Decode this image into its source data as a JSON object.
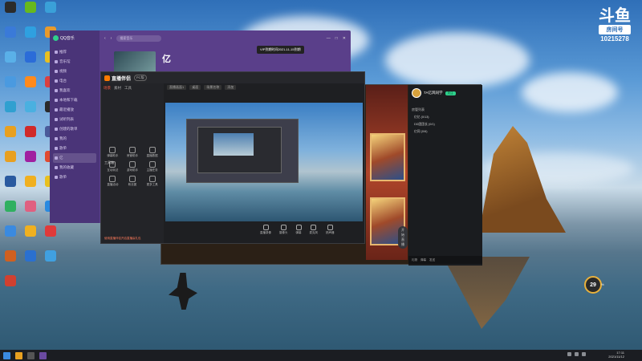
{
  "desktop": {
    "icons": [
      {
        "label": "",
        "color": "#2b2b2b"
      },
      {
        "label": "",
        "color": "#67b91d"
      },
      {
        "label": "",
        "color": "#3aa0d8"
      },
      {
        "label": "",
        "color": "#3a7ad8"
      },
      {
        "label": "",
        "color": "#2fa0e0"
      },
      {
        "label": "",
        "color": "#e89a2c"
      },
      {
        "label": "",
        "color": "#5ab0e8"
      },
      {
        "label": "",
        "color": "#2b6cd8"
      },
      {
        "label": "",
        "color": "#e8c020"
      },
      {
        "label": "",
        "color": "#4a9ae0"
      },
      {
        "label": "",
        "color": "#ff8a1c"
      },
      {
        "label": "",
        "color": "#d94040"
      },
      {
        "label": "",
        "color": "#30a0d0"
      },
      {
        "label": "",
        "color": "#4ab0e0"
      },
      {
        "label": "",
        "color": "#2a2a2a"
      },
      {
        "label": "",
        "color": "#e8a020"
      },
      {
        "label": "",
        "color": "#d02a2a"
      },
      {
        "label": "",
        "color": "#4a5a9a"
      },
      {
        "label": "",
        "color": "#e8a020"
      },
      {
        "label": "",
        "color": "#a020a0"
      },
      {
        "label": "",
        "color": "#e04a30"
      },
      {
        "label": "",
        "color": "#2a5aa0"
      },
      {
        "label": "",
        "color": "#f0b020"
      },
      {
        "label": "",
        "color": "#e8c020"
      },
      {
        "label": "",
        "color": "#30b060"
      },
      {
        "label": "",
        "color": "#e06080"
      },
      {
        "label": "",
        "color": "#2a8ae0"
      },
      {
        "label": "",
        "color": "#3a8ae0"
      },
      {
        "label": "",
        "color": "#f0b020"
      },
      {
        "label": "",
        "color": "#e03a3a"
      },
      {
        "label": "",
        "color": "#d06020"
      },
      {
        "label": "",
        "color": "#2a70d0"
      },
      {
        "label": "",
        "color": "#40a0e0"
      },
      {
        "label": "",
        "color": "#d04030"
      }
    ]
  },
  "watermark": {
    "logo": "斗鱼",
    "room_label": "房间号",
    "room_number": "10215278"
  },
  "qqmusic": {
    "app_name": "QQ音乐",
    "search_placeholder": "搜索音乐",
    "tooltip": "VIP到期时间2021-11-15到期",
    "song_title": "亿",
    "nav": [
      "推荐",
      "音乐馆",
      "视频",
      "电台",
      "我喜欢",
      "本地和下载",
      "最近播放",
      "试听列表",
      "创建的歌单",
      "我的",
      "歌单",
      "亿",
      "我的收藏",
      "歌单"
    ],
    "active_index": 11,
    "window_controls": [
      "—",
      "□",
      "✕"
    ]
  },
  "douyu_companion": {
    "app_name": "直播伴侣",
    "version": "PC版",
    "tabs": [
      "场景",
      "素材",
      "工具"
    ],
    "active_tab": 0,
    "section_title": "工具箱",
    "tools": [
      "弹幕助手",
      "房管助手",
      "直播数据",
      "互动玩法",
      "游戏助手",
      "主播任务",
      "直播活动",
      "粉丝团",
      "更多工具"
    ],
    "subtabs": [
      "直播画面1",
      "桌面",
      "场景名称",
      "添加"
    ],
    "bottom_bar": [
      "直播录像",
      "摄像头",
      "弹幕",
      "麦克风",
      "扬声器"
    ],
    "start_button": "开始直播",
    "bottom_note": "使用直播伴侣开启直播赢礼包"
  },
  "live_room": {
    "streamer_name": "7A亿风同学",
    "follow_label": "关注",
    "viewers": "14",
    "fans": "3995",
    "list_title": "房管列表",
    "list_items": [
      "亿亿 (0/13)",
      "DD团团长 (0/1)",
      "亿同 (0/6)"
    ],
    "footer": [
      "礼物",
      "弹幕",
      "发送"
    ]
  },
  "float_ball": {
    "value": "29",
    "unit": "%"
  },
  "taskbar": {
    "time": "17:11",
    "date": "2021/11/12"
  }
}
